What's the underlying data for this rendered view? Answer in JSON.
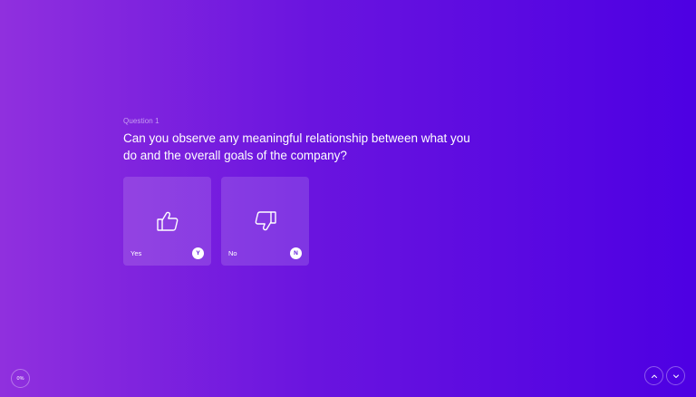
{
  "question": {
    "number_label": "Question 1",
    "text": "Can you observe any meaningful relationship between what you do and the overall goals of the company?"
  },
  "options": [
    {
      "label": "Yes",
      "key": "Y",
      "icon": "thumbs-up-icon"
    },
    {
      "label": "No",
      "key": "N",
      "icon": "thumbs-down-icon"
    }
  ],
  "progress": {
    "label": "0%",
    "value": 0
  },
  "navigation": {
    "up_icon": "chevron-up-icon",
    "down_icon": "chevron-down-icon"
  },
  "colors": {
    "gradient_start": "#9030de",
    "gradient_end": "#4d00e3",
    "key_text": "#5a14d8"
  }
}
